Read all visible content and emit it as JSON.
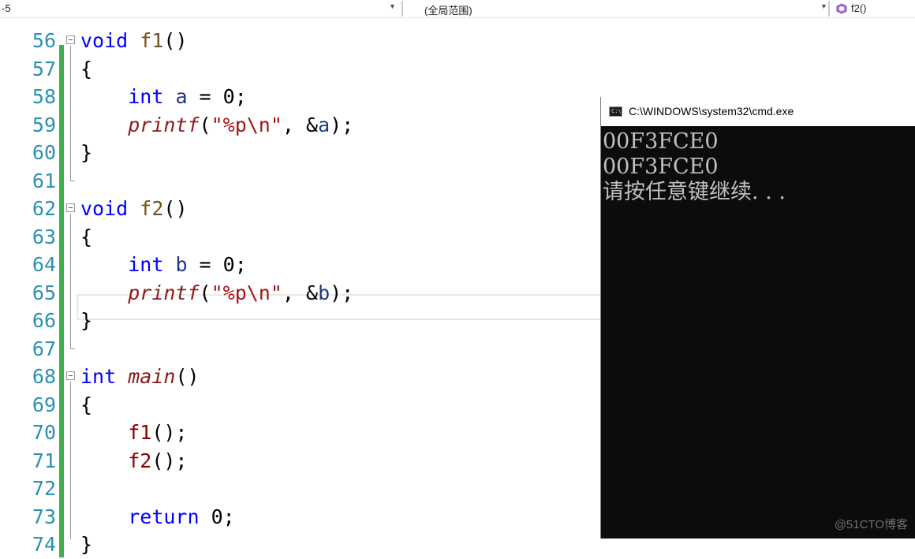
{
  "navbar": {
    "left_text": "-5",
    "scope_dropdown": "(全局范围)",
    "function_dropdown": "f2()"
  },
  "code_lines": [
    {
      "ln": "56",
      "tokens": [
        {
          "t": "void",
          "c": "kw"
        },
        {
          "t": " "
        },
        {
          "t": "f1",
          "c": "fnc"
        },
        {
          "t": "()"
        }
      ]
    },
    {
      "ln": "57",
      "tokens": [
        {
          "t": "{"
        }
      ]
    },
    {
      "ln": "58",
      "tokens": [
        {
          "t": "    "
        },
        {
          "t": "int",
          "c": "kw"
        },
        {
          "t": " "
        },
        {
          "t": "a",
          "c": "var"
        },
        {
          "t": " = 0;"
        }
      ]
    },
    {
      "ln": "59",
      "tokens": [
        {
          "t": "    "
        },
        {
          "t": "printf",
          "c": "it"
        },
        {
          "t": "("
        },
        {
          "t": "\"%p\\n\"",
          "c": "str"
        },
        {
          "t": ", &"
        },
        {
          "t": "a",
          "c": "var"
        },
        {
          "t": ");"
        }
      ]
    },
    {
      "ln": "60",
      "tokens": [
        {
          "t": "}"
        }
      ]
    },
    {
      "ln": "61",
      "tokens": []
    },
    {
      "ln": "62",
      "tokens": [
        {
          "t": "void",
          "c": "kw"
        },
        {
          "t": " "
        },
        {
          "t": "f2",
          "c": "fnc"
        },
        {
          "t": "()"
        }
      ]
    },
    {
      "ln": "63",
      "tokens": [
        {
          "t": "{"
        }
      ]
    },
    {
      "ln": "64",
      "tokens": [
        {
          "t": "    "
        },
        {
          "t": "int",
          "c": "kw"
        },
        {
          "t": " "
        },
        {
          "t": "b",
          "c": "var"
        },
        {
          "t": " = 0;"
        }
      ]
    },
    {
      "ln": "65",
      "tokens": [
        {
          "t": "    "
        },
        {
          "t": "printf",
          "c": "it"
        },
        {
          "t": "("
        },
        {
          "t": "\"%p\\n\"",
          "c": "str"
        },
        {
          "t": ", &"
        },
        {
          "t": "b",
          "c": "var"
        },
        {
          "t": ");"
        }
      ]
    },
    {
      "ln": "66",
      "tokens": [
        {
          "t": "}"
        }
      ]
    },
    {
      "ln": "67",
      "tokens": []
    },
    {
      "ln": "68",
      "tokens": [
        {
          "t": "int",
          "c": "kw"
        },
        {
          "t": " "
        },
        {
          "t": "main",
          "c": "it"
        },
        {
          "t": "()"
        }
      ]
    },
    {
      "ln": "69",
      "tokens": [
        {
          "t": "{"
        }
      ]
    },
    {
      "ln": "70",
      "tokens": [
        {
          "t": "    "
        },
        {
          "t": "f1",
          "c": "fcall"
        },
        {
          "t": "();"
        }
      ]
    },
    {
      "ln": "71",
      "tokens": [
        {
          "t": "    "
        },
        {
          "t": "f2",
          "c": "fcall"
        },
        {
          "t": "();"
        }
      ]
    },
    {
      "ln": "72",
      "tokens": []
    },
    {
      "ln": "73",
      "tokens": [
        {
          "t": "    "
        },
        {
          "t": "return",
          "c": "kw"
        },
        {
          "t": " 0;"
        }
      ]
    },
    {
      "ln": "74",
      "tokens": [
        {
          "t": "}"
        }
      ]
    }
  ],
  "console": {
    "title": "C:\\WINDOWS\\system32\\cmd.exe",
    "output": [
      "00F3FCE0",
      "00F3FCE0",
      "请按任意键继续. . ."
    ],
    "watermark": "@51CTO博客"
  },
  "colors": {
    "keyword": "#0000ff",
    "line_number": "#2b91af",
    "change_bar": "#3cb34a",
    "console_bg": "#0c0c0c",
    "console_text": "#c0c0c0"
  }
}
